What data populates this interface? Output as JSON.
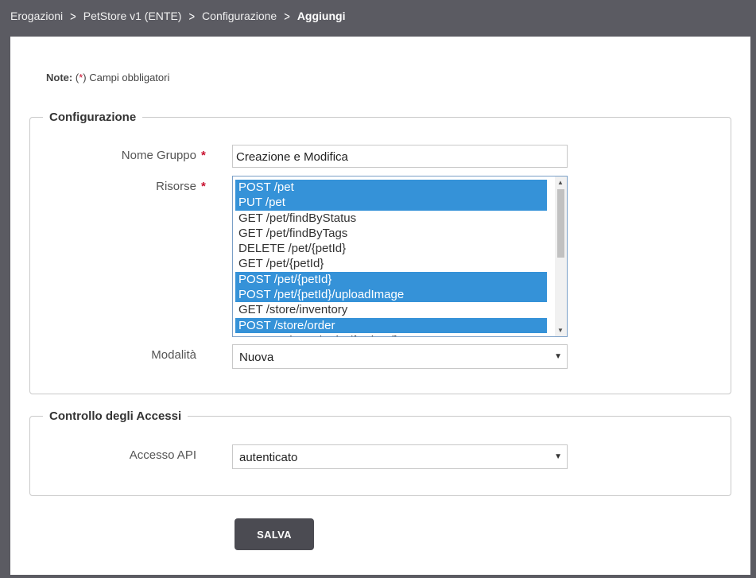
{
  "breadcrumb": {
    "items": [
      "Erogazioni",
      "PetStore v1 (ENTE)",
      "Configurazione"
    ],
    "current": "Aggiungi",
    "separator": ">"
  },
  "note": {
    "label": "Note:",
    "open": "(",
    "star": "*",
    "close": ")",
    "text": " Campi obbligatori"
  },
  "configurazione": {
    "legend": "Configurazione",
    "nome_gruppo": {
      "label": "Nome Gruppo",
      "required": "*",
      "value": "Creazione e Modifica"
    },
    "risorse": {
      "label": "Risorse",
      "required": "*",
      "options": [
        {
          "text": "POST /pet",
          "selected": true
        },
        {
          "text": "PUT /pet",
          "selected": true
        },
        {
          "text": "GET /pet/findByStatus",
          "selected": false
        },
        {
          "text": "GET /pet/findByTags",
          "selected": false
        },
        {
          "text": "DELETE /pet/{petId}",
          "selected": false
        },
        {
          "text": "GET /pet/{petId}",
          "selected": false
        },
        {
          "text": "POST /pet/{petId}",
          "selected": true
        },
        {
          "text": "POST /pet/{petId}/uploadImage",
          "selected": true
        },
        {
          "text": "GET /store/inventory",
          "selected": false
        },
        {
          "text": "POST /store/order",
          "selected": true
        },
        {
          "text": "DELETE /store/order/{orderId}",
          "selected": false
        }
      ]
    },
    "modalita": {
      "label": "Modalità",
      "value": "Nuova"
    }
  },
  "controllo_accessi": {
    "legend": "Controllo degli Accessi",
    "accesso_api": {
      "label": "Accesso API",
      "value": "autenticato"
    }
  },
  "actions": {
    "save_label": "SALVA"
  },
  "colors": {
    "selected_option": "#3592d8",
    "required_star": "#c8102e",
    "button": "#4b4b52"
  }
}
